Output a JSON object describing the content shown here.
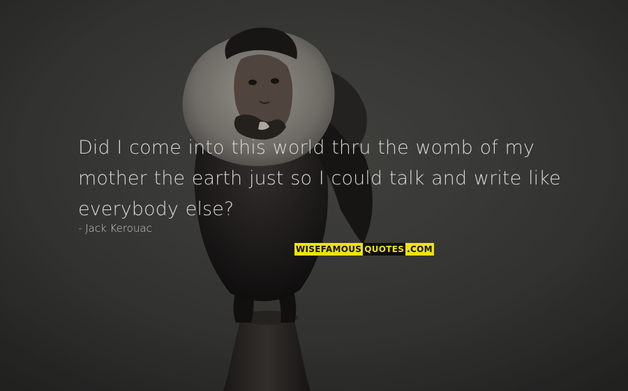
{
  "quote": {
    "line1": "Did I come into this world thru the womb of my",
    "line2": "mother the earth just so I could talk and write like",
    "line3": "everybody else?"
  },
  "author": "- Jack Kerouac",
  "watermark": {
    "part1": "WISEFAMOUS",
    "part2": "QUOTES",
    "part3": ".COM"
  },
  "colors": {
    "background": "#3a3a38",
    "text": "#d7d7d4",
    "watermark_yellow": "#f1e20e",
    "watermark_black": "#0e0e0e"
  }
}
